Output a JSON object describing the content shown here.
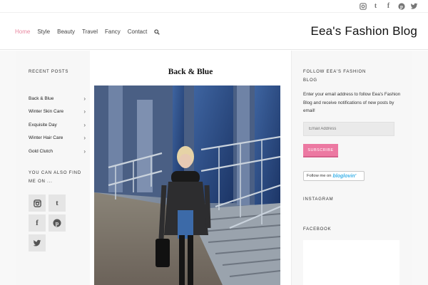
{
  "top_social": [
    "instagram-icon",
    "tumblr-icon",
    "facebook-icon",
    "pinterest-icon",
    "twitter-icon"
  ],
  "nav": {
    "items": [
      "Home",
      "Style",
      "Beauty",
      "Travel",
      "Fancy",
      "Contact"
    ],
    "active": "Home"
  },
  "site_title": "Eea's Fashion Blog",
  "left_sidebar": {
    "recent_heading": "RECENT POSTS",
    "recent_posts": [
      "Back & Blue",
      "Winter Skin Care",
      "Exquisite Day",
      "Winter Hair Care",
      "Gold Clutch"
    ],
    "find_heading": "YOU CAN ALSO FIND ME ON ...",
    "social": [
      "instagram-icon",
      "tumblr-icon",
      "facebook-icon",
      "pinterest-icon",
      "twitter-icon"
    ]
  },
  "post": {
    "title": "Back & Blue"
  },
  "right_sidebar": {
    "follow_heading": "FOLLOW EEA'S FASHION BLOG",
    "follow_text": "Enter your email address to follow Eea's Fashion Blog and receive notifications of new posts by email!",
    "email_placeholder": "Email Address",
    "subscribe_label": "SUBSCRIBE",
    "bloglovin_prefix": "Follow me on",
    "bloglovin_brand": "bloglovin'",
    "instagram_heading": "INSTAGRAM",
    "facebook_heading": "FACEBOOK"
  },
  "colors": {
    "accent_pink": "#ec79a2",
    "nav_active": "#e8869f",
    "bloglovin_blue": "#3bb1e8"
  }
}
